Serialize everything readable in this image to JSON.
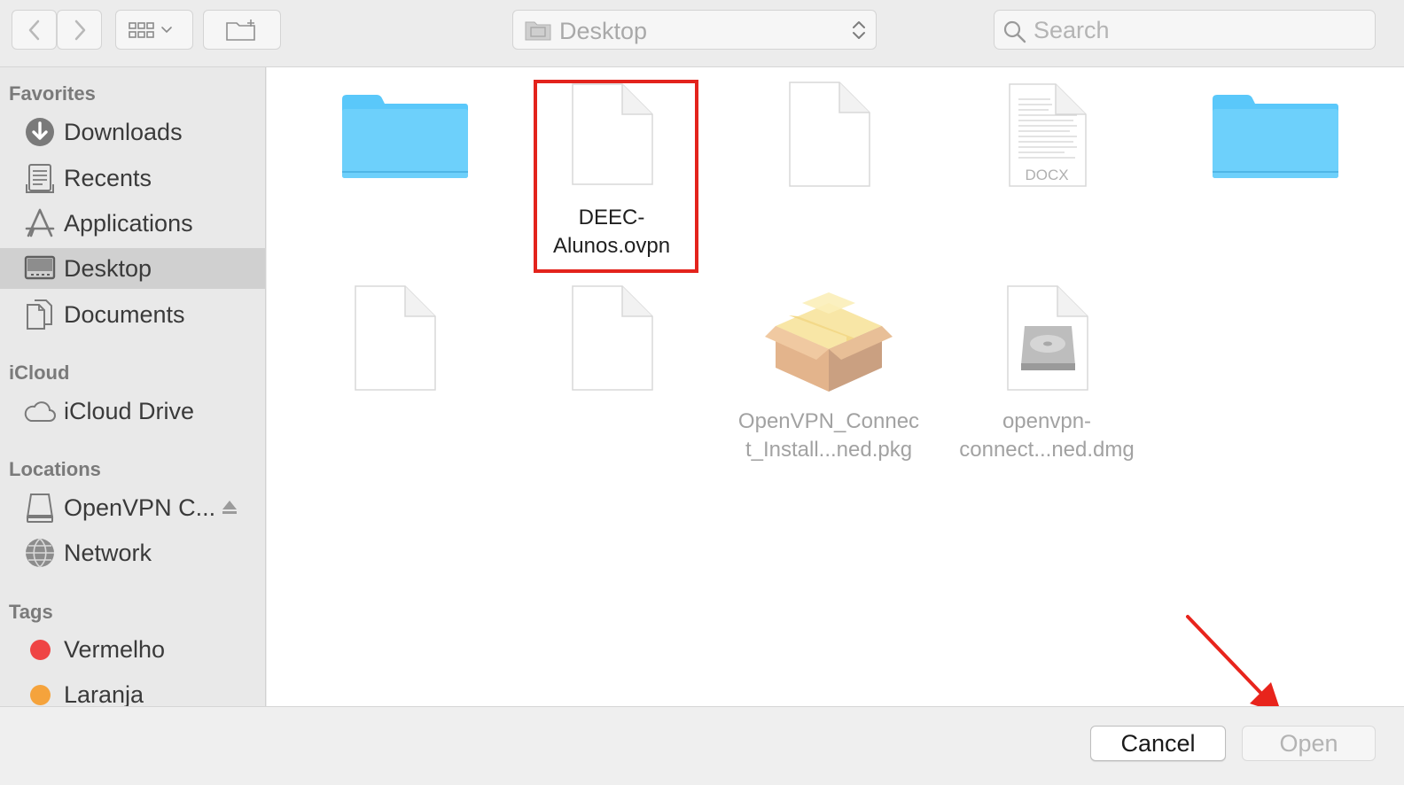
{
  "toolbar": {
    "location": "Desktop",
    "search_placeholder": "Search"
  },
  "sidebar": {
    "favorites_title": "Favorites",
    "favorites": [
      {
        "label": "Downloads",
        "icon": "downloads-icon"
      },
      {
        "label": "Recents",
        "icon": "recents-icon"
      },
      {
        "label": "Applications",
        "icon": "applications-icon"
      },
      {
        "label": "Desktop",
        "icon": "desktop-icon",
        "selected": true
      },
      {
        "label": "Documents",
        "icon": "documents-icon"
      }
    ],
    "icloud_title": "iCloud",
    "icloud": [
      {
        "label": "iCloud Drive",
        "icon": "cloud-icon"
      }
    ],
    "locations_title": "Locations",
    "locations": [
      {
        "label": "OpenVPN C...",
        "icon": "disk-icon"
      },
      {
        "label": "Network",
        "icon": "network-icon"
      }
    ],
    "tags_title": "Tags",
    "tags": [
      {
        "label": "Vermelho",
        "color": "#ef4444"
      },
      {
        "label": "Laranja",
        "color": "#f5a33c"
      }
    ]
  },
  "files": [
    {
      "name": "",
      "type": "folder"
    },
    {
      "name": "DEEC-\nAlunos.ovpn",
      "type": "document",
      "selected": true
    },
    {
      "name": "",
      "type": "document"
    },
    {
      "name": "",
      "type": "docx",
      "badge": "DOCX"
    },
    {
      "name": "",
      "type": "folder"
    },
    {
      "name": "",
      "type": "document"
    },
    {
      "name": "",
      "type": "document"
    },
    {
      "name": "OpenVPN_Connec\nt_Install...ned.pkg",
      "type": "package"
    },
    {
      "name": "openvpn-\nconnect...ned.dmg",
      "type": "disk-image"
    }
  ],
  "footer": {
    "cancel_label": "Cancel",
    "open_label": "Open"
  },
  "colors": {
    "highlight": "#e3231c",
    "folder": "#5ac8fa",
    "selected_sidebar": "#d0d0d0"
  }
}
